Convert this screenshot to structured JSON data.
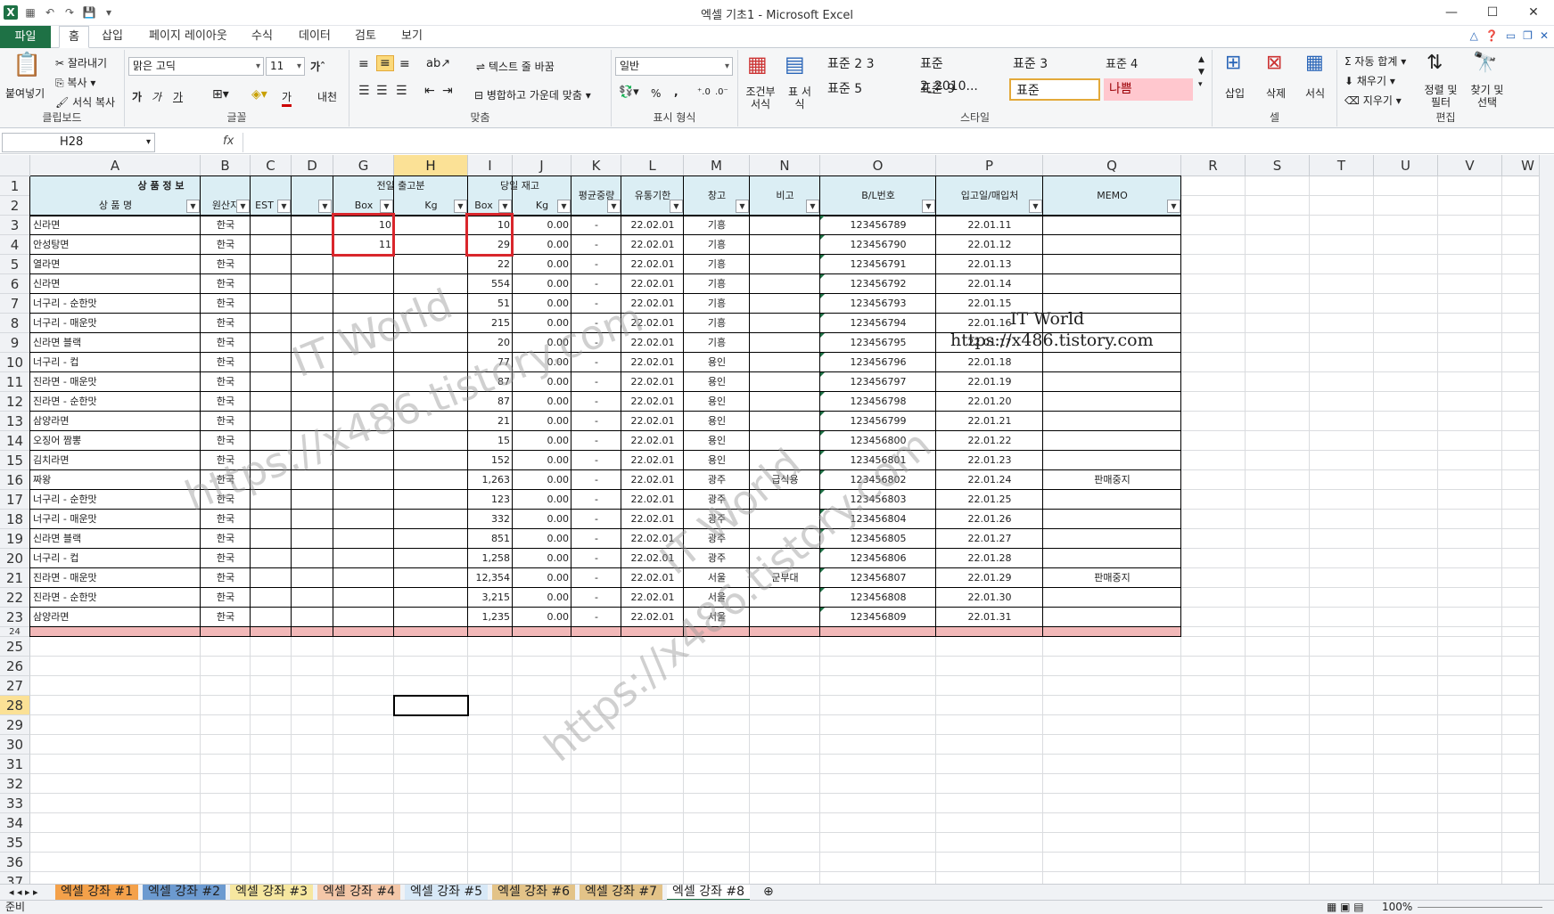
{
  "window": {
    "title": "엑셀 기초1 - Microsoft Excel",
    "minimize": "—",
    "restore": "☐",
    "close": "✕"
  },
  "ribbon_tabs": [
    "파일",
    "홈",
    "삽입",
    "페이지 레이아웃",
    "수식",
    "데이터",
    "검토",
    "보기"
  ],
  "clipboard": {
    "paste": "붙여넣기",
    "cut": "잘라내기",
    "copy": "복사 ▾",
    "format_painter": "서식 복사",
    "label": "클립보드"
  },
  "font": {
    "name": "맑은 고딕",
    "size": "11",
    "bold": "가",
    "italic": "가",
    "underline": "가",
    "label": "글꼴",
    "color_glyph": "가",
    "phonetic": "내천"
  },
  "alignment": {
    "wrap": "텍스트 줄 바꿈",
    "merge": "병합하고 가운데 맞춤",
    "label": "맞춤"
  },
  "number": {
    "format": "일반",
    "percent": "%",
    "comma": ",",
    "label": "표시 형식"
  },
  "styles": {
    "cond": "조건부 서식",
    "table": "표 서식",
    "items": [
      "표준 2 3",
      "표준 2_2010...",
      "표준 3",
      "표준 4",
      "표준 5",
      "표준 9",
      "표준",
      "나쁨"
    ],
    "label": "스타일"
  },
  "cells": {
    "insert": "삽입",
    "delete": "삭제",
    "format": "서식",
    "label": "셀"
  },
  "editing": {
    "autosum": "자동 합계",
    "fill": "채우기",
    "clear": "지우기",
    "sort": "정렬 및 필터",
    "find": "찾기 및 선택",
    "label": "편집"
  },
  "formula_bar": {
    "name_box": "H28",
    "fx": "fx",
    "value": ""
  },
  "columns": [
    "A",
    "B",
    "C",
    "D",
    "G",
    "H",
    "I",
    "J",
    "K",
    "L",
    "M",
    "N",
    "O",
    "P",
    "Q",
    "R",
    "S",
    "T",
    "U",
    "V",
    "W"
  ],
  "row_numbers": [
    "1",
    "2",
    "3",
    "4",
    "5",
    "6",
    "7",
    "8",
    "9",
    "10",
    "11",
    "12",
    "13",
    "14",
    "15",
    "16",
    "17",
    "18",
    "19",
    "20",
    "21",
    "22",
    "23",
    "24",
    "25",
    "26",
    "27",
    "28",
    "29",
    "30",
    "31",
    "32",
    "33",
    "34",
    "35",
    "36",
    "37"
  ],
  "headers": {
    "product_info": "상 품 정 보",
    "prev_day_out": "전일 출고분",
    "today_stock": "당일 재고",
    "avg_weight": "평균중량",
    "expiry": "유통기한",
    "warehouse": "창고",
    "remark": "비고",
    "bl_no": "B/L번호",
    "in_date": "입고일/매입처",
    "memo": "MEMO",
    "product_name": "상 품 명",
    "origin": "원산지",
    "est": "EST",
    "box1": "Box",
    "kg1": "Kg",
    "box2": "Box",
    "kg2": "Kg"
  },
  "rows": [
    {
      "name": "신라면",
      "origin": "한국",
      "g": "10",
      "i": "10",
      "j": "0.00",
      "k": "-",
      "l": "22.02.01",
      "m": "기흥",
      "n": "",
      "o": "123456789",
      "p": "22.01.11",
      "q": ""
    },
    {
      "name": "안성탕면",
      "origin": "한국",
      "g": "11",
      "i": "29",
      "j": "0.00",
      "k": "-",
      "l": "22.02.01",
      "m": "기흥",
      "n": "",
      "o": "123456790",
      "p": "22.01.12",
      "q": ""
    },
    {
      "name": "열라면",
      "origin": "한국",
      "g": "",
      "i": "22",
      "j": "0.00",
      "k": "-",
      "l": "22.02.01",
      "m": "기흥",
      "n": "",
      "o": "123456791",
      "p": "22.01.13",
      "q": ""
    },
    {
      "name": "신라면",
      "origin": "한국",
      "g": "",
      "i": "554",
      "j": "0.00",
      "k": "-",
      "l": "22.02.01",
      "m": "기흥",
      "n": "",
      "o": "123456792",
      "p": "22.01.14",
      "q": ""
    },
    {
      "name": "너구리 - 순한맛",
      "origin": "한국",
      "g": "",
      "i": "51",
      "j": "0.00",
      "k": "-",
      "l": "22.02.01",
      "m": "기흥",
      "n": "",
      "o": "123456793",
      "p": "22.01.15",
      "q": ""
    },
    {
      "name": "너구리 - 매운맛",
      "origin": "한국",
      "g": "",
      "i": "215",
      "j": "0.00",
      "k": "-",
      "l": "22.02.01",
      "m": "기흥",
      "n": "",
      "o": "123456794",
      "p": "22.01.16",
      "q": ""
    },
    {
      "name": "신라면 블랙",
      "origin": "한국",
      "g": "",
      "i": "20",
      "j": "0.00",
      "k": "-",
      "l": "22.02.01",
      "m": "기흥",
      "n": "",
      "o": "123456795",
      "p": "22.01.17",
      "q": ""
    },
    {
      "name": "너구리 - 컵",
      "origin": "한국",
      "g": "",
      "i": "77",
      "j": "0.00",
      "k": "-",
      "l": "22.02.01",
      "m": "용인",
      "n": "",
      "o": "123456796",
      "p": "22.01.18",
      "q": ""
    },
    {
      "name": "진라면 - 매운맛",
      "origin": "한국",
      "g": "",
      "i": "87",
      "j": "0.00",
      "k": "-",
      "l": "22.02.01",
      "m": "용인",
      "n": "",
      "o": "123456797",
      "p": "22.01.19",
      "q": ""
    },
    {
      "name": "진라면 - 순한맛",
      "origin": "한국",
      "g": "",
      "i": "87",
      "j": "0.00",
      "k": "-",
      "l": "22.02.01",
      "m": "용인",
      "n": "",
      "o": "123456798",
      "p": "22.01.20",
      "q": ""
    },
    {
      "name": "삼양라면",
      "origin": "한국",
      "g": "",
      "i": "21",
      "j": "0.00",
      "k": "-",
      "l": "22.02.01",
      "m": "용인",
      "n": "",
      "o": "123456799",
      "p": "22.01.21",
      "q": ""
    },
    {
      "name": "오징어 짬뽕",
      "origin": "한국",
      "g": "",
      "i": "15",
      "j": "0.00",
      "k": "-",
      "l": "22.02.01",
      "m": "용인",
      "n": "",
      "o": "123456800",
      "p": "22.01.22",
      "q": ""
    },
    {
      "name": "김치라면",
      "origin": "한국",
      "g": "",
      "i": "152",
      "j": "0.00",
      "k": "-",
      "l": "22.02.01",
      "m": "용인",
      "n": "",
      "o": "123456801",
      "p": "22.01.23",
      "q": ""
    },
    {
      "name": "짜왕",
      "origin": "한국",
      "g": "",
      "i": "1,263",
      "j": "0.00",
      "k": "-",
      "l": "22.02.01",
      "m": "광주",
      "n": "급식용",
      "o": "123456802",
      "p": "22.01.24",
      "q": "판매중지"
    },
    {
      "name": "너구리 - 순한맛",
      "origin": "한국",
      "g": "",
      "i": "123",
      "j": "0.00",
      "k": "-",
      "l": "22.02.01",
      "m": "광주",
      "n": "",
      "o": "123456803",
      "p": "22.01.25",
      "q": ""
    },
    {
      "name": "너구리 - 매운맛",
      "origin": "한국",
      "g": "",
      "i": "332",
      "j": "0.00",
      "k": "-",
      "l": "22.02.01",
      "m": "광주",
      "n": "",
      "o": "123456804",
      "p": "22.01.26",
      "q": ""
    },
    {
      "name": "신라면 블랙",
      "origin": "한국",
      "g": "",
      "i": "851",
      "j": "0.00",
      "k": "-",
      "l": "22.02.01",
      "m": "광주",
      "n": "",
      "o": "123456805",
      "p": "22.01.27",
      "q": ""
    },
    {
      "name": "너구리 - 컵",
      "origin": "한국",
      "g": "",
      "i": "1,258",
      "j": "0.00",
      "k": "-",
      "l": "22.02.01",
      "m": "광주",
      "n": "",
      "o": "123456806",
      "p": "22.01.28",
      "q": ""
    },
    {
      "name": "진라면 - 매운맛",
      "origin": "한국",
      "g": "",
      "i": "12,354",
      "j": "0.00",
      "k": "-",
      "l": "22.02.01",
      "m": "서울",
      "n": "군부대",
      "o": "123456807",
      "p": "22.01.29",
      "q": "판매중지"
    },
    {
      "name": "진라면 - 순한맛",
      "origin": "한국",
      "g": "",
      "i": "3,215",
      "j": "0.00",
      "k": "-",
      "l": "22.02.01",
      "m": "서울",
      "n": "",
      "o": "123456808",
      "p": "22.01.30",
      "q": ""
    },
    {
      "name": "삼양라면",
      "origin": "한국",
      "g": "",
      "i": "1,235",
      "j": "0.00",
      "k": "-",
      "l": "22.02.01",
      "m": "서울",
      "n": "",
      "o": "123456809",
      "p": "22.01.31",
      "q": ""
    }
  ],
  "watermark": {
    "title": "IT World",
    "url": "https://x486.tistory.com"
  },
  "sheet_tabs": [
    "엑셀 강좌 #1",
    "엑셀 강좌 #2",
    "엑셀 강좌 #3",
    "엑셀 강좌 #4",
    "엑셀 강좌 #5",
    "엑셀 강좌 #6",
    "엑셀 강좌 #7",
    "엑셀 강좌 #8"
  ],
  "status": {
    "ready": "준비",
    "zoom": "100%"
  }
}
